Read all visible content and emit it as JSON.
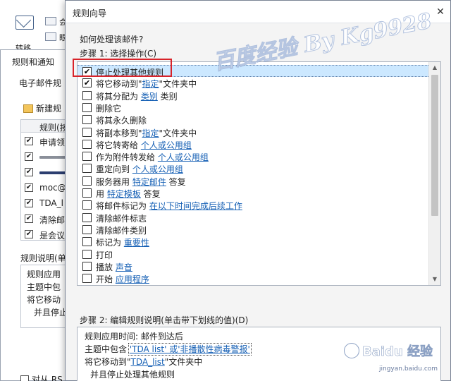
{
  "ribbon": {
    "lbl1": "转移",
    "mini1": "会",
    "mini2": "眼"
  },
  "background_dialog": {
    "title": "规则和通知",
    "tab": "电子邮件规",
    "new_rule": "新建规",
    "grid_header": "规则(按",
    "rows": [
      {
        "checked": true,
        "text": "申请领",
        "bar": ""
      },
      {
        "checked": true,
        "text": "",
        "bar": "#8a8f99"
      },
      {
        "checked": true,
        "text": "",
        "bar": "#2c3e70"
      },
      {
        "checked": true,
        "text": "moc@",
        "bar": ""
      },
      {
        "checked": true,
        "text": "TDA_l",
        "bar": ""
      },
      {
        "checked": true,
        "text": "清除邮",
        "bar": ""
      },
      {
        "checked": true,
        "text": "是会议",
        "bar": ""
      }
    ],
    "desc_title": "规则说明(单",
    "desc_lines": [
      "规则应用",
      "主题中包",
      "将它移动",
      "并且停止"
    ],
    "rss": "对从 RS"
  },
  "wizard": {
    "title": "规则向导",
    "close": "✕",
    "question": "如何处理该邮件?",
    "step1_label": "步骤 1: 选择操作(C)",
    "actions": [
      {
        "checked": true,
        "selected": true,
        "pre": "停止处理其他规则",
        "link": "",
        "post": "",
        "dashed": false
      },
      {
        "checked": true,
        "selected": false,
        "pre": "将它移动到\"",
        "link": "指定",
        "post": "\"文件夹中",
        "dashed": false
      },
      {
        "checked": false,
        "selected": false,
        "pre": "将其分配为 ",
        "link": "类别",
        "post": " 类别",
        "dashed": false
      },
      {
        "checked": false,
        "selected": false,
        "pre": "删除它",
        "link": "",
        "post": "",
        "dashed": false
      },
      {
        "checked": false,
        "selected": false,
        "pre": "将其永久删除",
        "link": "",
        "post": "",
        "dashed": false
      },
      {
        "checked": false,
        "selected": false,
        "pre": "将副本移到\"",
        "link": "指定",
        "post": "\"文件夹中",
        "dashed": false
      },
      {
        "checked": false,
        "selected": false,
        "pre": "将它转寄给 ",
        "link": "个人或公用组",
        "post": "",
        "dashed": false
      },
      {
        "checked": false,
        "selected": false,
        "pre": "作为附件转发给 ",
        "link": "个人或公用组",
        "post": "",
        "dashed": false
      },
      {
        "checked": false,
        "selected": false,
        "pre": "重定向到 ",
        "link": "个人或公用组",
        "post": "",
        "dashed": false
      },
      {
        "checked": false,
        "selected": false,
        "pre": "服务器用 ",
        "link": "特定邮件",
        "post": " 答复",
        "dashed": false
      },
      {
        "checked": false,
        "selected": false,
        "pre": "用 ",
        "link": "特定模板",
        "post": " 答复",
        "dashed": false
      },
      {
        "checked": false,
        "selected": false,
        "pre": "将邮件标记为 ",
        "link": "在以下时间完成后续工作",
        "post": "",
        "dashed": false
      },
      {
        "checked": false,
        "selected": false,
        "pre": "清除邮件标志",
        "link": "",
        "post": "",
        "dashed": false
      },
      {
        "checked": false,
        "selected": false,
        "pre": "清除邮件类别",
        "link": "",
        "post": "",
        "dashed": false
      },
      {
        "checked": false,
        "selected": false,
        "pre": "标记为 ",
        "link": "重要性",
        "post": "",
        "dashed": false
      },
      {
        "checked": false,
        "selected": false,
        "pre": "打印",
        "link": "",
        "post": "",
        "dashed": false
      },
      {
        "checked": false,
        "selected": false,
        "pre": "播放 ",
        "link": "声音",
        "post": "",
        "dashed": false
      },
      {
        "checked": false,
        "selected": false,
        "pre": "开始 ",
        "link": "应用程序",
        "post": "",
        "dashed": false
      }
    ],
    "step2_label": "步骤 2: 编辑规则说明(单击带下划线的值)(D)",
    "desc": {
      "line1": "规则应用时间: 邮件到达后",
      "line2_pre": "主题中包含 ",
      "line2_link": "'TDA list' 或'非播散性病毒警报'",
      "line3_pre": "将它移动到\"",
      "line3_link": "TDA_list",
      "line3_post": "\"文件夹中",
      "line4": "并且停止处理其他规则"
    }
  },
  "watermark": "百度经验 By Kg9928",
  "baidu_logo": "Baidu 经验",
  "baidu_url": "jingyan.baidu.com",
  "colors": {
    "link": "#1660b5",
    "selection": "#cce8ff",
    "highlight_box": "#d8232a"
  }
}
